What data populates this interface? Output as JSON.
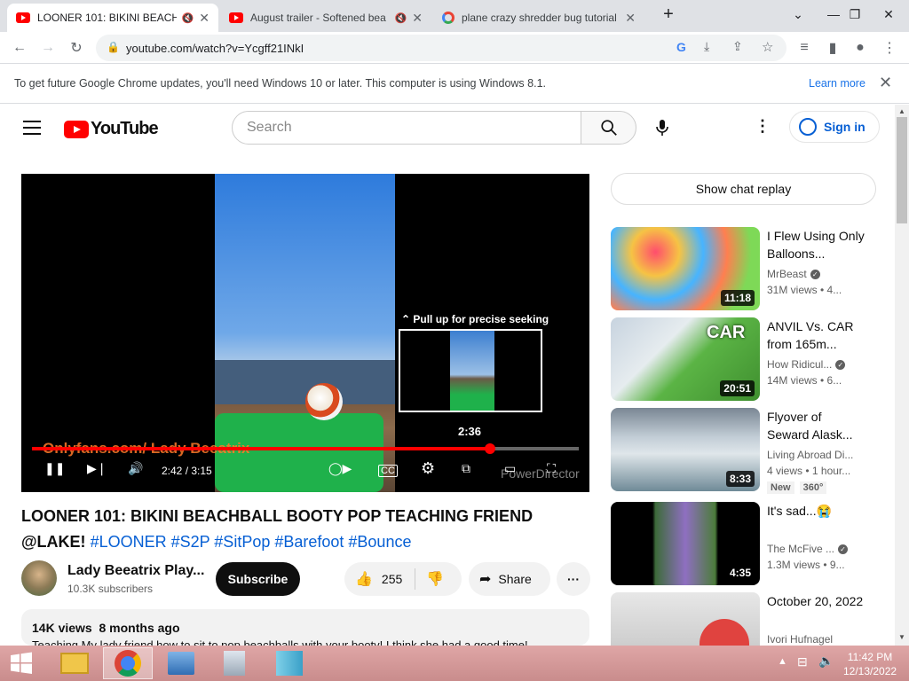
{
  "browser": {
    "tabs": [
      {
        "title": "LOONER 101: BIKINI BEACHBALL",
        "muted_icon": "🔇",
        "active": true
      },
      {
        "title": "August trailer - Softened bea",
        "muted_icon": "🔇",
        "active": false
      },
      {
        "title": "plane crazy shredder bug tutorial",
        "muted_icon": "",
        "active": false
      }
    ],
    "new_tab": "+",
    "url": "youtube.com/watch?v=Ycgff21INkI",
    "infobar_text": "To get future Google Chrome updates, you'll need Windows 10 or later. This computer is using Windows 8.1.",
    "infobar_link": "Learn more"
  },
  "youtube": {
    "logo_text": "YouTube",
    "search_placeholder": "Search",
    "sign_in": "Sign in",
    "chat_replay": "Show chat replay"
  },
  "player": {
    "seek_hint": "⌃ Pull up for precise seeking",
    "seek_time": "2:36",
    "watermark": "Onlyfans.com/ Lady Beeatrix",
    "time": "2:42 / 3:15",
    "progress_fraction": 0.837,
    "badge": "PowerDirector"
  },
  "video": {
    "title": "LOONER 101: BIKINI BEACHBALL BOOTY POP TEACHING FRIEND @LAKE!",
    "hashtags": "#LOONER #S2P #SitPop #Barefoot #Bounce",
    "channel": "Lady Beeatrix Play...",
    "subscribers": "10.3K subscribers",
    "subscribe": "Subscribe",
    "likes": "255",
    "share": "Share",
    "views": "14K views",
    "age": "8 months ago",
    "description": "Teaching My lady friend how to sit to pop beachballs with your booty! I think she had a good time!"
  },
  "recommendations": [
    {
      "title": "I Flew Using Only Balloons...",
      "channel": "MrBeast",
      "meta": "31M views • 4...",
      "duration": "11:18",
      "verified": true,
      "badges": []
    },
    {
      "title": "ANVIL Vs. CAR from 165m...",
      "channel": "How Ridicul...",
      "meta": "14M views • 6...",
      "duration": "20:51",
      "verified": true,
      "badges": []
    },
    {
      "title": "Flyover of Seward Alask...",
      "channel": "Living Abroad Di...",
      "meta": "4 views • 1 hour...",
      "duration": "8:33",
      "verified": false,
      "badges": [
        "New",
        "360°"
      ]
    },
    {
      "title": "It's sad...😭",
      "channel": "The McFive ...",
      "meta": "1.3M views • 9...",
      "duration": "4:35",
      "verified": true,
      "badges": []
    },
    {
      "title": "October 20, 2022",
      "channel": "Ivori Hufnagel",
      "meta": "",
      "duration": "",
      "verified": false,
      "badges": []
    }
  ],
  "taskbar": {
    "time": "11:42 PM",
    "date": "12/13/2022"
  }
}
